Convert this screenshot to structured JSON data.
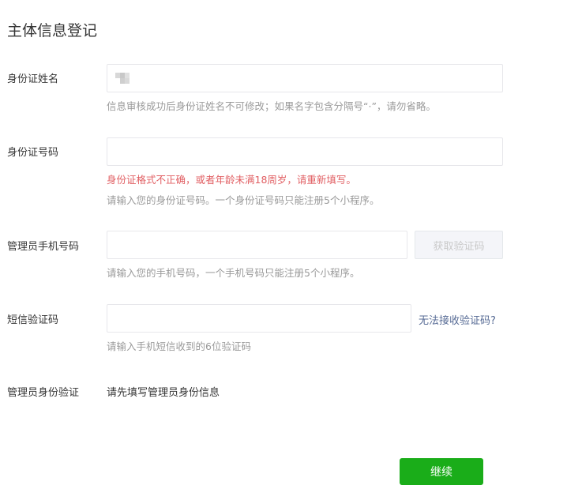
{
  "page_title": "主体信息登记",
  "fields": {
    "name": {
      "label": "身份证姓名",
      "tip": "信息审核成功后身份证姓名不可修改；如果名字包含分隔号“·”，请勿省略。"
    },
    "id_number": {
      "label": "身份证号码",
      "error": "身份证格式不正确，或者年龄未满18周岁，请重新填写。",
      "tip": "请输入您的身份证号码。一个身份证号码只能注册5个小程序。"
    },
    "phone": {
      "label": "管理员手机号码",
      "button": "获取验证码",
      "tip": "请输入您的手机号码，一个手机号码只能注册5个小程序。"
    },
    "sms": {
      "label": "短信验证码",
      "link": "无法接收验证码?",
      "tip": "请输入手机短信收到的6位验证码"
    },
    "verify": {
      "label": "管理员身份验证",
      "text": "请先填写管理员身份信息"
    }
  },
  "continue_label": "继续",
  "colors": {
    "primary": "#1aad19",
    "error": "#e15f63",
    "link": "#576b95"
  }
}
